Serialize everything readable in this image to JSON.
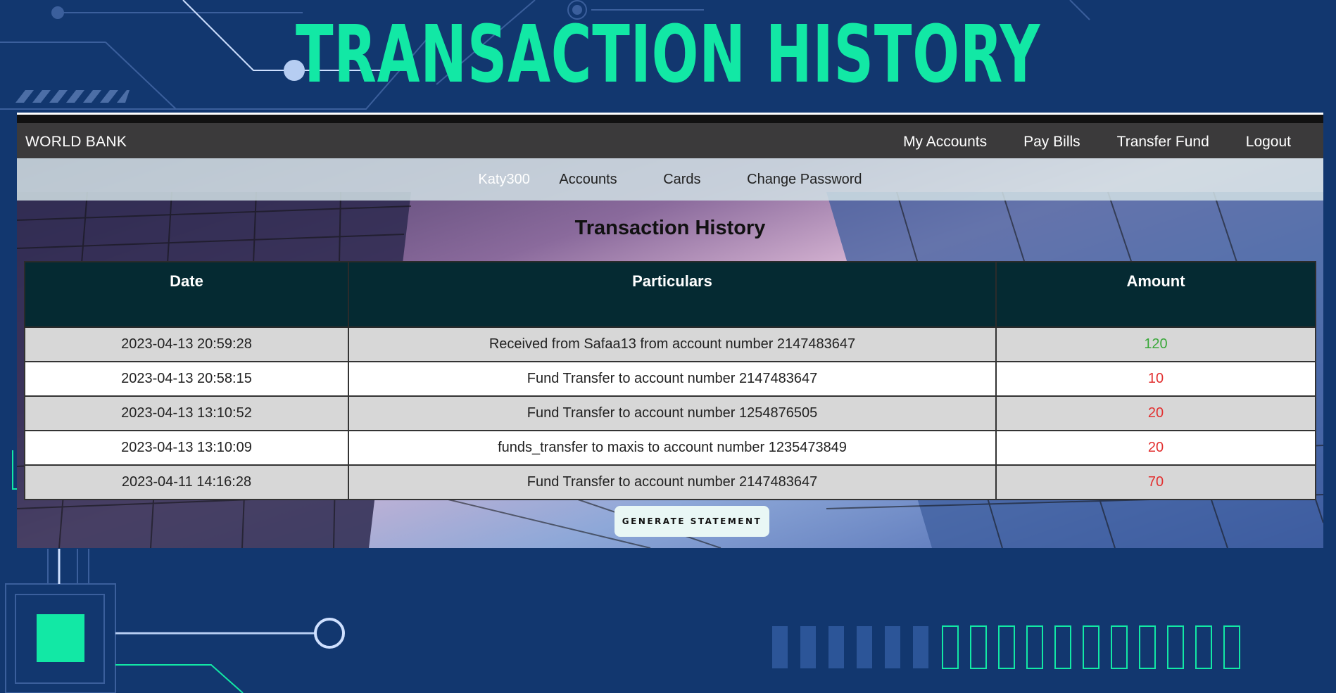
{
  "slide": {
    "title": "TRANSACTION HISTORY"
  },
  "colors": {
    "background": "#12376f",
    "accent": "#12e8a5",
    "incoming": "#3aa83a",
    "outgoing": "#e23030",
    "table_header": "#052a32"
  },
  "app": {
    "brand": "WORLD BANK",
    "nav": [
      "My Accounts",
      "Pay Bills",
      "Transfer Fund",
      "Logout"
    ],
    "subnav": {
      "user": "Katy300",
      "items": [
        "Accounts",
        "Cards",
        "Change Password"
      ]
    },
    "heading": "Transaction History",
    "table": {
      "headers": [
        "Date",
        "Particulars",
        "Amount"
      ],
      "rows": [
        {
          "date": "2023-04-13 20:59:28",
          "particulars": "Received from Safaa13 from account number 2147483647",
          "amount": "120",
          "type": "in"
        },
        {
          "date": "2023-04-13 20:58:15",
          "particulars": "Fund Transfer to account number 2147483647",
          "amount": "10",
          "type": "out"
        },
        {
          "date": "2023-04-13 13:10:52",
          "particulars": "Fund Transfer to account number 1254876505",
          "amount": "20",
          "type": "out"
        },
        {
          "date": "2023-04-13 13:10:09",
          "particulars": "funds_transfer to maxis to account number 1235473849",
          "amount": "20",
          "type": "out"
        },
        {
          "date": "2023-04-11 14:16:28",
          "particulars": "Fund Transfer to account number 2147483647",
          "amount": "70",
          "type": "out"
        }
      ]
    },
    "button": "GENERATE STATEMENT"
  }
}
